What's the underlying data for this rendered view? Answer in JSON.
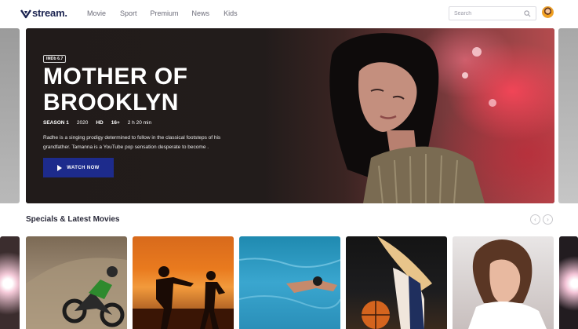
{
  "header": {
    "logo_text": "stream.",
    "nav": [
      "Movie",
      "Sport",
      "Premium",
      "News",
      "Kids"
    ],
    "search_placeholder": "Search"
  },
  "hero": {
    "badge": "IMDb 6.7",
    "title": "MOTHER OF BROOKLYN",
    "meta": {
      "season": "SEASON 1",
      "year": "2020",
      "quality": "HD",
      "rating": "16+",
      "duration": "2 h 20 min"
    },
    "description": "Radhe is a singing prodigy determined to follow in the classical footsteps of his grandfather. Tamanna is a YouTube pop sensation desperate to become .",
    "cta_label": "WATCH NOW"
  },
  "section": {
    "title": "Specials & Latest Movies"
  },
  "colors": {
    "brand": "#1b2350",
    "cta": "#1d2b8c"
  },
  "icons": {
    "search": "search-icon",
    "prev": "chevron-left-icon",
    "next": "chevron-right-icon",
    "play": "play-icon"
  }
}
